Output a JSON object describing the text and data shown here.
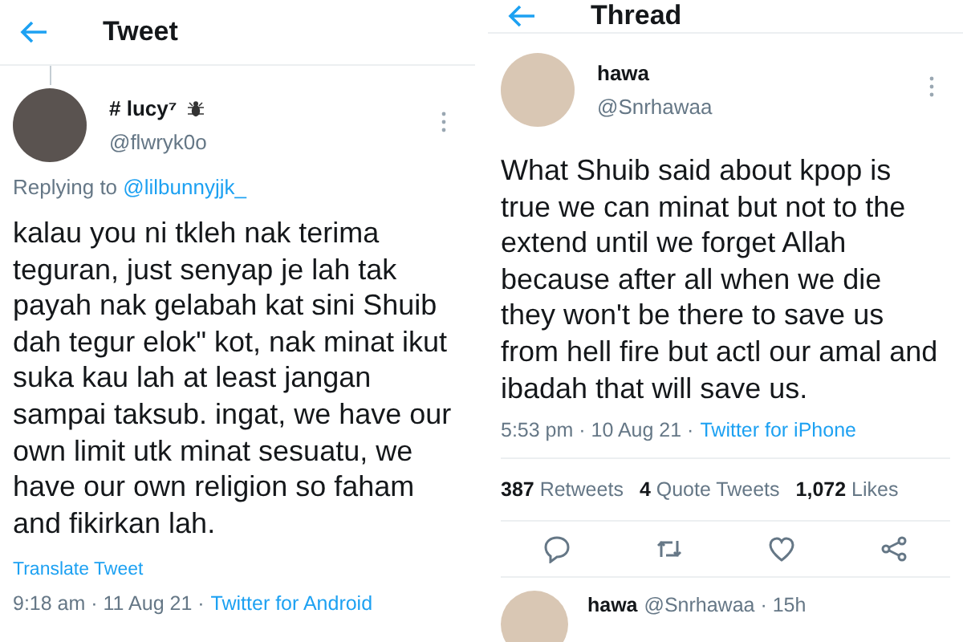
{
  "panels": [
    {
      "header": {
        "title": "Tweet"
      },
      "thread_line": true,
      "tweet": {
        "name": "# lucy⁷",
        "badge": true,
        "handle": "@flwryk0o",
        "replying_to": {
          "prefix": "Replying to",
          "handle": "@lilbunnyjjk_"
        },
        "text": "kalau you ni tkleh nak terima teguran, just senyap je lah tak payah nak gelabah kat sini Shuib dah tegur elok\" kot, nak minat ikut suka kau lah at least jangan sampai taksub. ingat, we have our own limit utk minat sesuatu, we have our own religion so faham and fikirkan lah.",
        "translate": "Translate Tweet",
        "timestamp": "9:18 am · 11 Aug 21 ·",
        "source": "Twitter for Android"
      }
    },
    {
      "header": {
        "title": "Thread"
      },
      "thread_line": false,
      "tweet": {
        "name": "hawa",
        "badge": false,
        "handle": "@Snrhawaa",
        "text": "What Shuib said about kpop is true we can minat but not to the extend until we forget Allah because after all when we die they won't be there to save us from hell fire but actl our amal and ibadah that will save us.",
        "timestamp": "5:53 pm · 10 Aug 21 ·",
        "source": "Twitter for iPhone",
        "stats": [
          {
            "count": "387",
            "label": "Retweets"
          },
          {
            "count": "4",
            "label": "Quote Tweets"
          },
          {
            "count": "1,072",
            "label": "Likes"
          }
        ]
      },
      "reply_preview": {
        "name": "hawa",
        "meta": "@Snrhawaa · 15h"
      }
    }
  ]
}
